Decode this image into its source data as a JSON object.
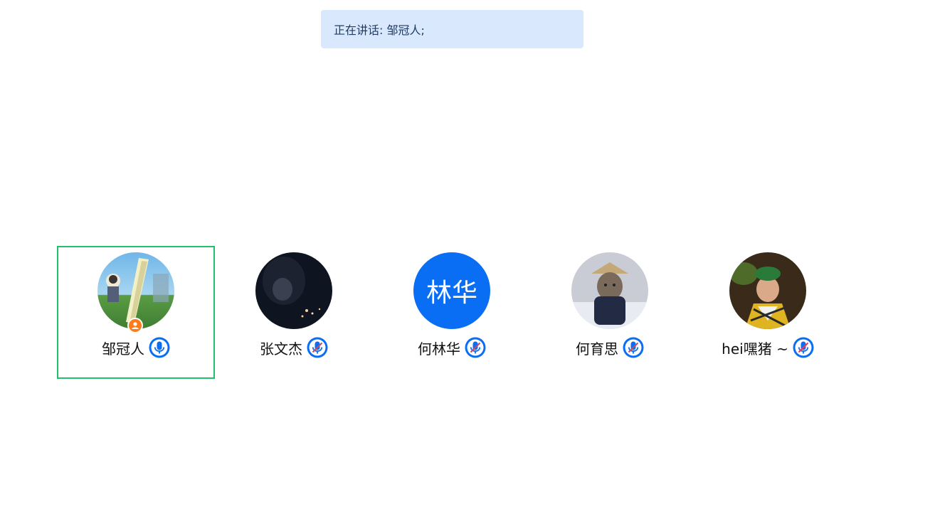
{
  "banner": {
    "text": "正在讲话: 邹冠人;"
  },
  "participants": [
    {
      "name": "邹冠人",
      "avatar_text": "",
      "mic": "on",
      "is_host": true,
      "speaking": true
    },
    {
      "name": "张文杰",
      "avatar_text": "",
      "mic": "muted",
      "is_host": false,
      "speaking": false
    },
    {
      "name": "何林华",
      "avatar_text": "林华",
      "mic": "muted",
      "is_host": false,
      "speaking": false
    },
    {
      "name": "何育思",
      "avatar_text": "",
      "mic": "muted",
      "is_host": false,
      "speaking": false
    },
    {
      "name": "hei嘿猪 ~",
      "avatar_text": "",
      "mic": "muted",
      "is_host": false,
      "speaking": false
    }
  ],
  "colors": {
    "accent": "#0a6ef5",
    "speaking_border": "#1fc16b",
    "host_badge": "#ff7a1a",
    "muted_slash": "#e0405a"
  }
}
